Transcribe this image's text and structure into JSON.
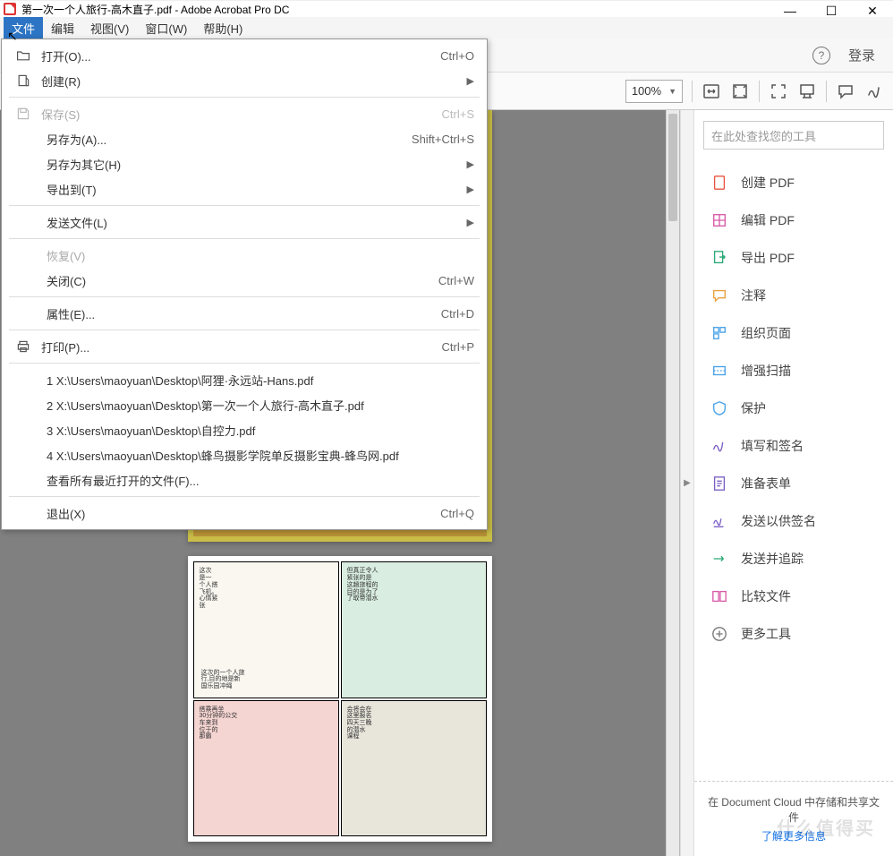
{
  "window": {
    "title": "第一次一个人旅行-高木直子.pdf - Adobe Acrobat Pro DC",
    "min": "—",
    "max": "☐",
    "close": "✕"
  },
  "menubar": {
    "file": "文件",
    "edit": "编辑",
    "view": "视图(V)",
    "window": "窗口(W)",
    "help": "帮助(H)"
  },
  "header": {
    "help": "?",
    "login": "登录"
  },
  "toolbar": {
    "zoom": "100%"
  },
  "file_menu": {
    "open": "打开(O)...",
    "open_sc": "Ctrl+O",
    "create": "创建(R)",
    "save": "保存(S)",
    "save_sc": "Ctrl+S",
    "save_as": "另存为(A)...",
    "save_as_sc": "Shift+Ctrl+S",
    "save_as_other": "另存为其它(H)",
    "export_to": "导出到(T)",
    "send_file": "发送文件(L)",
    "revert": "恢复(V)",
    "close": "关闭(C)",
    "close_sc": "Ctrl+W",
    "properties": "属性(E)...",
    "properties_sc": "Ctrl+D",
    "print": "打印(P)...",
    "print_sc": "Ctrl+P",
    "recent1": "1 X:\\Users\\maoyuan\\Desktop\\阿狸·永远站-Hans.pdf",
    "recent2": "2 X:\\Users\\maoyuan\\Desktop\\第一次一个人旅行-高木直子.pdf",
    "recent3": "3 X:\\Users\\maoyuan\\Desktop\\自控力.pdf",
    "recent4": "4 X:\\Users\\maoyuan\\Desktop\\蜂鸟摄影学院单反摄影宝典-蜂鸟网.pdf",
    "view_all_recent": "查看所有最近打开的文件(F)...",
    "exit": "退出(X)",
    "exit_sc": "Ctrl+Q"
  },
  "right_panel": {
    "search_placeholder": "在此处查找您的工具",
    "create_pdf": "创建 PDF",
    "edit_pdf": "编辑 PDF",
    "export_pdf": "导出 PDF",
    "comment": "注释",
    "organize": "组织页面",
    "enhance_scan": "增强扫描",
    "protect": "保护",
    "fill_sign": "填写和签名",
    "prepare_form": "准备表单",
    "send_sign": "发送以供签名",
    "send_track": "发送并追踪",
    "compare": "比较文件",
    "more_tools": "更多工具",
    "cloud_note": "在 Document Cloud 中存储和共享文件",
    "cloud_link": "了解更多信息"
  },
  "watermark": "什么值得买",
  "collapse_arrow": "▶"
}
